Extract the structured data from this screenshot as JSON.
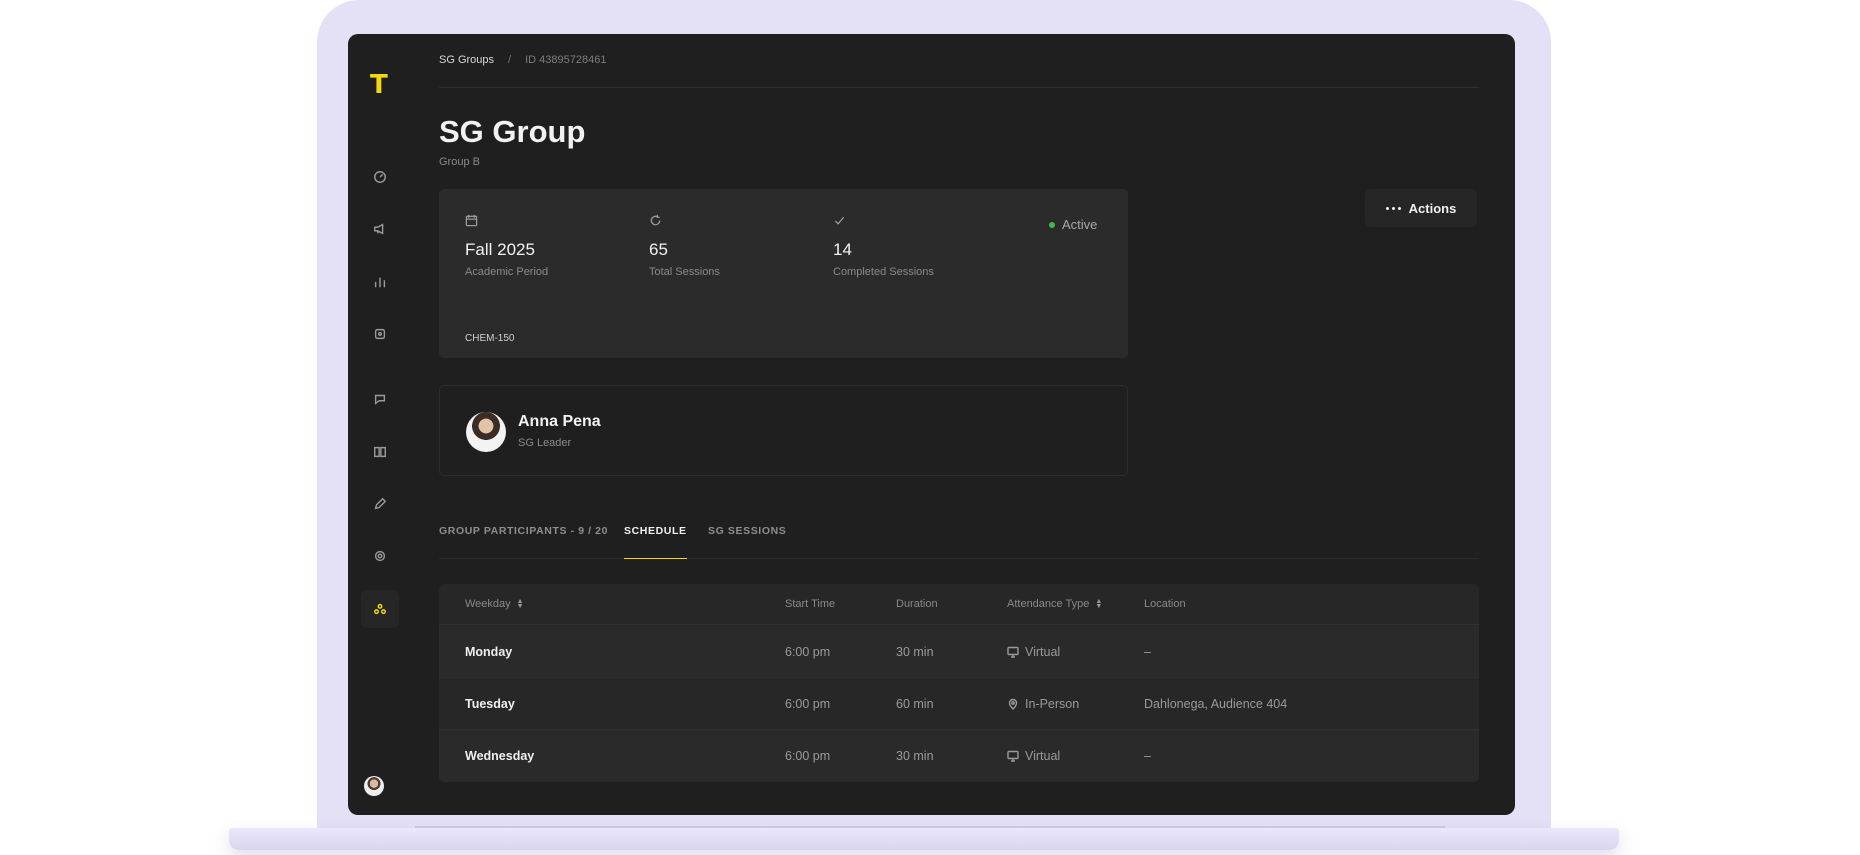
{
  "app": {
    "logo": "T"
  },
  "breadcrumb": {
    "parent": "SG Groups",
    "separator": "/",
    "current": "ID 43895728461"
  },
  "page": {
    "title": "SG Group",
    "subtitle": "Group B"
  },
  "actions": {
    "label": "Actions"
  },
  "info_card": {
    "stats": [
      {
        "icon": "calendar-icon",
        "value": "Fall 2025",
        "label": "Academic Period"
      },
      {
        "icon": "refresh-icon",
        "value": "65",
        "label": "Total Sessions"
      },
      {
        "icon": "check-icon",
        "value": "14",
        "label": "Completed Sessions"
      }
    ],
    "status": "Active",
    "status_color": "#3fb950",
    "course_tag": "CHEM-150"
  },
  "leader": {
    "name": "Anna Pena",
    "role": "SG Leader"
  },
  "tabs": [
    {
      "label": "GROUP PARTICIPANTS - 9 / 20",
      "active": false
    },
    {
      "label": "SCHEDULE",
      "active": true
    },
    {
      "label": "SG SESSIONS",
      "active": false
    }
  ],
  "table": {
    "headers": [
      "Weekday",
      "Start Time",
      "Duration",
      "Attendance Type",
      "Location"
    ],
    "rows": [
      {
        "weekday": "Monday",
        "start": "6:00 pm",
        "duration": "30 min",
        "type": "Virtual",
        "type_icon": "monitor-icon",
        "location": "–"
      },
      {
        "weekday": "Tuesday",
        "start": "6:00 pm",
        "duration": "60 min",
        "type": "In-Person",
        "type_icon": "map-pin-icon",
        "location": "Dahlonega, Audience 404"
      },
      {
        "weekday": "Wednesday",
        "start": "6:00 pm",
        "duration": "30 min",
        "type": "Virtual",
        "type_icon": "monitor-icon",
        "location": "–"
      }
    ]
  },
  "theme": {
    "accent": "#f5d90a",
    "background": "#1f1f1f",
    "card": "#2b2b2b"
  }
}
